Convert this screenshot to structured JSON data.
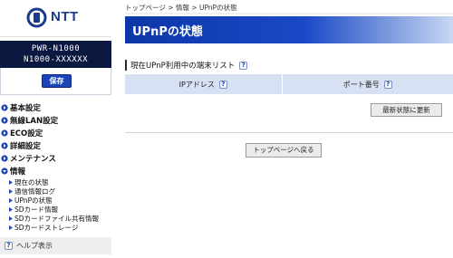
{
  "brand": {
    "logo_text": "NTT"
  },
  "device": {
    "model": "PWR-N1000",
    "serial": "N1000-XXXXXX",
    "save_label": "保存"
  },
  "sidebar": {
    "menu": [
      {
        "label": "基本設定"
      },
      {
        "label": "無線LAN設定"
      },
      {
        "label": "ECO設定"
      },
      {
        "label": "詳細設定"
      },
      {
        "label": "メンテナンス"
      },
      {
        "label": "情報"
      }
    ],
    "info_submenu": [
      {
        "label": "現在の状態"
      },
      {
        "label": "通信情報ログ"
      },
      {
        "label": "UPnPの状態"
      },
      {
        "label": "SDカード情報"
      },
      {
        "label": "SDカードファイル共有情報"
      },
      {
        "label": "SDカードストレージ"
      }
    ],
    "help_label": "ヘルプ表示"
  },
  "breadcrumb": "トップページ > 情報 > UPnPの状態",
  "page": {
    "title": "UPnPの状態",
    "section_title": "現在UPnP利用中の端末リスト",
    "table": {
      "headers": [
        "IPアドレス",
        "ポート番号"
      ]
    },
    "refresh_label": "最新状態に更新",
    "back_label": "トップページへ戻る"
  },
  "icons": {
    "help": "?",
    "nav_arrow": "arrow-circle-icon",
    "sub_arrow": "triangle-right-icon"
  },
  "colors": {
    "accent": "#1a45b8",
    "title_bar": "#0d37a8",
    "device_panel": "#0b1840",
    "table_header": "#d8e0f3"
  }
}
